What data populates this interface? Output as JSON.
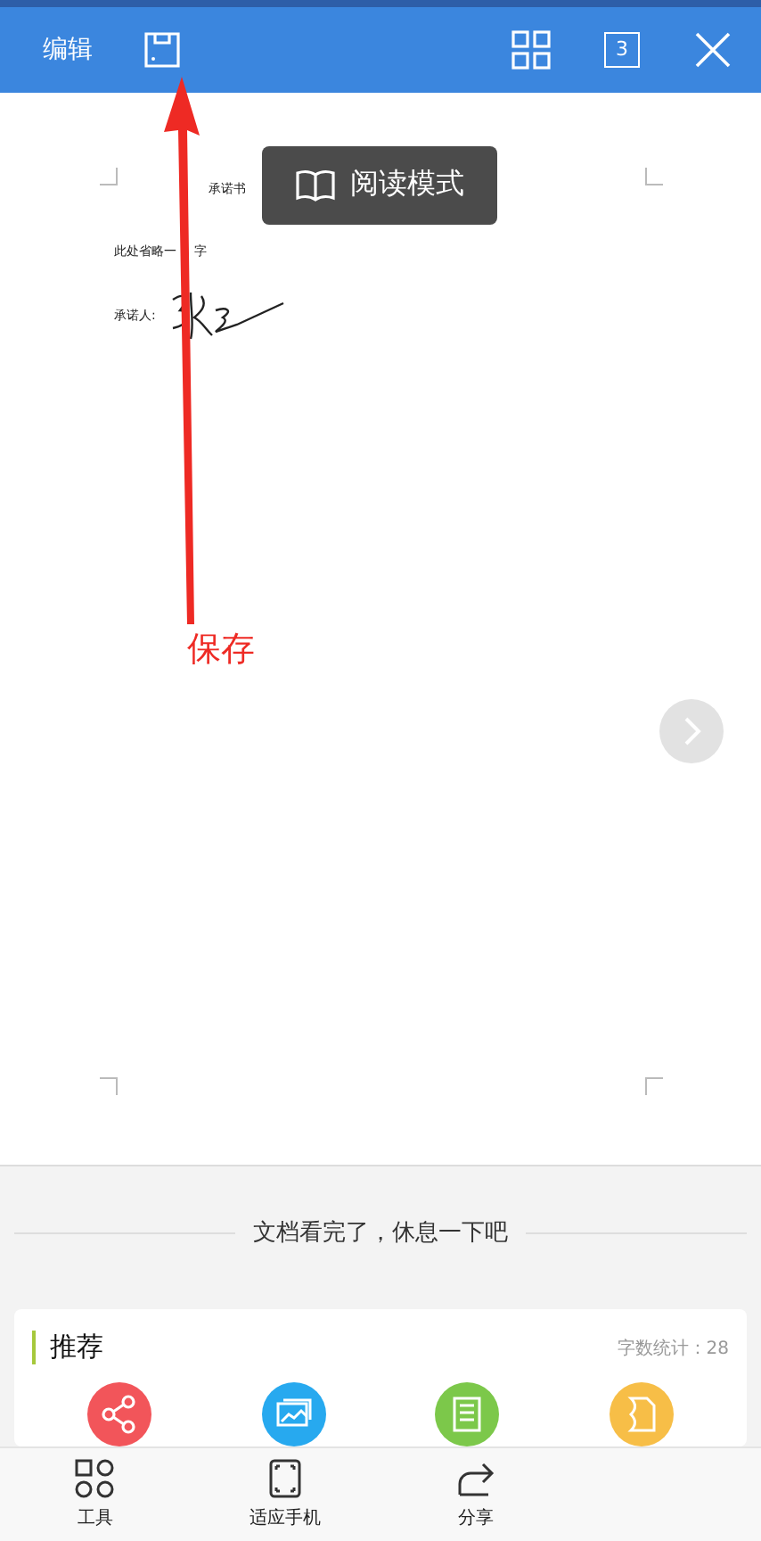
{
  "top_bar": {
    "edit_label": "编辑",
    "page_count": "3"
  },
  "document": {
    "title": "承诺书",
    "body_parts": [
      "此处省略一",
      "字"
    ],
    "signer_label": "承诺人:"
  },
  "reading_mode": {
    "label": "阅读模式"
  },
  "annotation": {
    "label": "保存"
  },
  "end_notice": "文档看完了，休息一下吧",
  "recommend": {
    "title": "推荐",
    "word_count": "字数统计：28",
    "items": [
      {
        "kind": "share",
        "color": "#f2555a"
      },
      {
        "kind": "image",
        "color": "#27a9ef"
      },
      {
        "kind": "document",
        "color": "#7cc84a"
      },
      {
        "kind": "file",
        "color": "#f7be47"
      }
    ]
  },
  "bottom_bar": [
    {
      "kind": "tools",
      "label": "工具"
    },
    {
      "kind": "fit",
      "label": "适应手机"
    },
    {
      "kind": "share",
      "label": "分享"
    }
  ]
}
